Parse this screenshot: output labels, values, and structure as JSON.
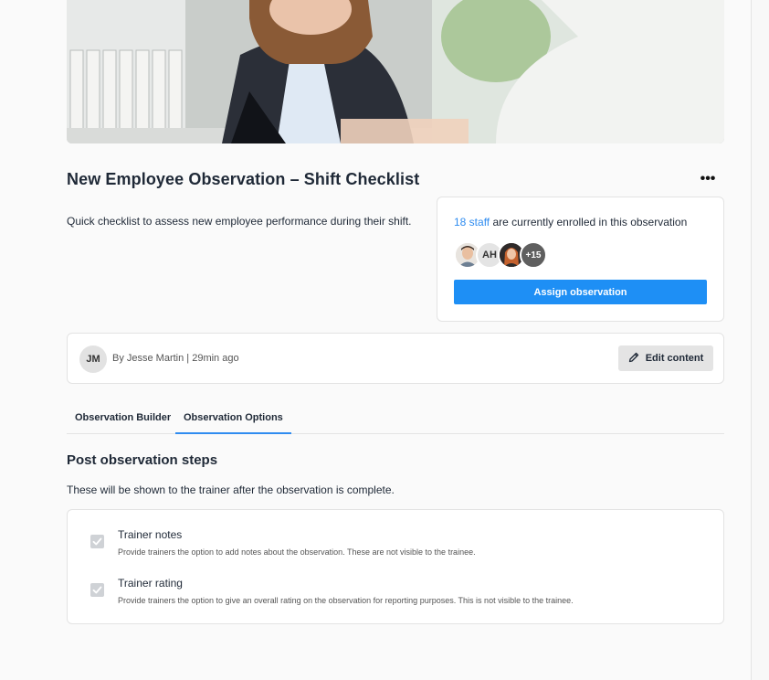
{
  "page": {
    "title": "New Employee Observation – Shift Checklist",
    "more_label": "•••",
    "description": "Quick checklist to assess new employee performance during their shift."
  },
  "enrollment": {
    "count_link": "18 staff",
    "suffix_text": " are currently enrolled in this observation",
    "avatars": [
      {
        "type": "photo",
        "name": "male-photo-avatar"
      },
      {
        "type": "initials",
        "text": "AH"
      },
      {
        "type": "photo",
        "name": "female-photo-avatar"
      },
      {
        "type": "more",
        "text": "+15"
      }
    ],
    "assign_label": "Assign observation",
    "accent": "#1e8ff5"
  },
  "author": {
    "initials": "JM",
    "meta": "By Jesse Martin | 29min ago",
    "edit_label": "Edit content",
    "edit_icon": "pencil-icon"
  },
  "tabs": [
    {
      "label": "Observation Builder",
      "active": false
    },
    {
      "label": "Observation Options",
      "active": true
    }
  ],
  "post_steps": {
    "title": "Post observation steps",
    "subtitle": "These will be shown to the trainer after the observation is complete.",
    "items": [
      {
        "title": "Trainer notes",
        "description": "Provide trainers the option to add notes about the observation. These are not visible to the trainee.",
        "checked": true
      },
      {
        "title": "Trainer rating",
        "description": "Provide trainers the option to give an overall rating on the observation for reporting purposes. This is not visible to the trainee.",
        "checked": true
      }
    ]
  }
}
